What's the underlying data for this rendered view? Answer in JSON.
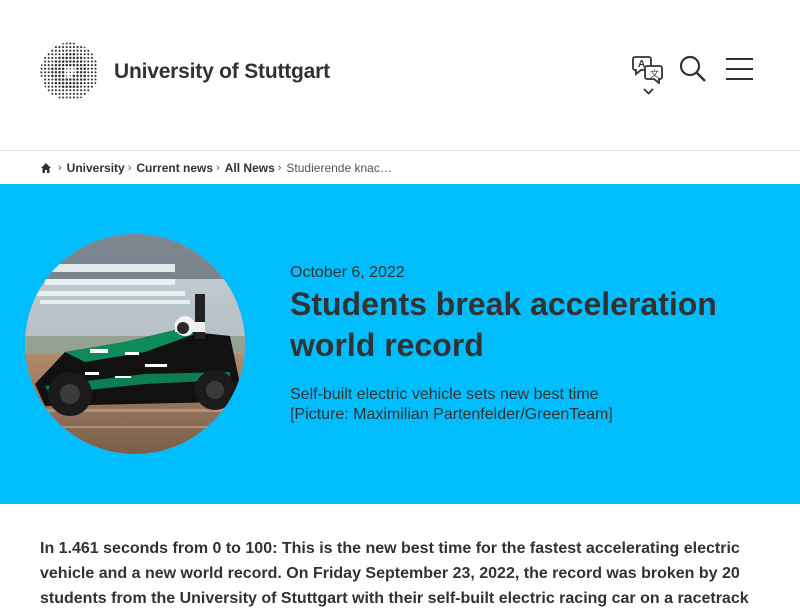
{
  "header": {
    "logo_text": "University of Stuttgart",
    "language_icon": "language-switch-icon",
    "search_icon": "search-icon",
    "menu_icon": "hamburger-menu-icon"
  },
  "breadcrumb": {
    "home_icon": "home-icon",
    "items": [
      "University",
      "Current news",
      "All News"
    ],
    "current": "Studierende knac…"
  },
  "hero": {
    "background_color": "#00befe",
    "date": "October 6, 2022",
    "title": "Students break acceleration world record",
    "caption_line1": "Self-built electric vehicle sets new best time",
    "caption_line2": "[Picture: Maximilian Partenfelder/GreenTeam]"
  },
  "article": {
    "intro": "In 1.461 seconds from 0 to 100: This is the new best time for the fastest accelerating electric vehicle and a new world record. On Friday September 23, 2022, the record was broken by 20 students from the University of Stuttgart with their self-built electric racing car on a racetrack"
  }
}
